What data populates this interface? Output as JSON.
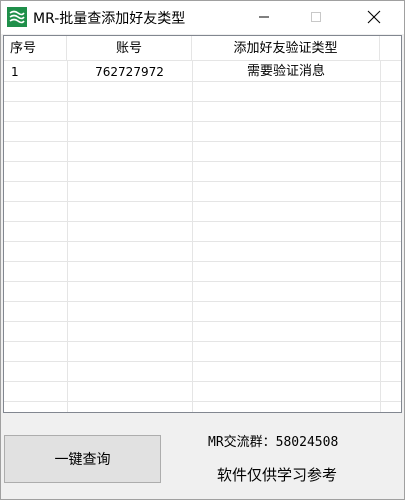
{
  "window": {
    "title": "MR-批量查添加好友类型"
  },
  "table": {
    "columns": [
      "序号",
      "账号",
      "添加好友验证类型"
    ],
    "rows": [
      [
        "1",
        "762727972",
        "需要验证消息"
      ]
    ]
  },
  "bottom": {
    "query_button": "一键查询",
    "group_label": "MR交流群：58024508",
    "note_label": "软件仅供学习参考"
  },
  "colors": {
    "icon_green": "#1f8f4a",
    "grid": "#e5e5e5",
    "button_bg": "#e1e1e1"
  }
}
